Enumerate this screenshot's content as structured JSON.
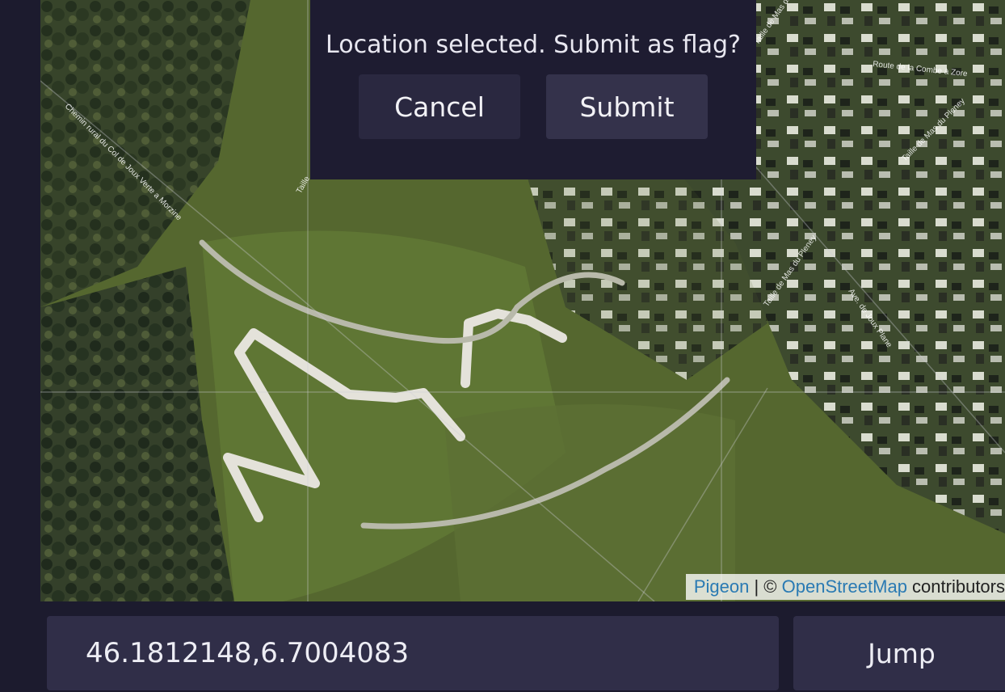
{
  "confirm_dialog": {
    "prompt": "Location selected. Submit as flag?",
    "cancel_label": "Cancel",
    "submit_label": "Submit"
  },
  "map": {
    "attribution": {
      "link1": "Pigeon",
      "separator": " | © ",
      "link2": "OpenStreetMap",
      "suffix": " contributors"
    },
    "street_labels": [
      "Chemin rural du Col de Joux Verte a Morzine",
      "Route de la Combe à Zore",
      "Taille de Mas du Pleney",
      "Taille de Mas du Pleney",
      "Taille de Mas du Grand Mas",
      "Ave. de Joux Plane",
      "Taille"
    ]
  },
  "coordinates_input": {
    "value": "46.1812148,6.7004083"
  },
  "jump_label": "Jump"
}
